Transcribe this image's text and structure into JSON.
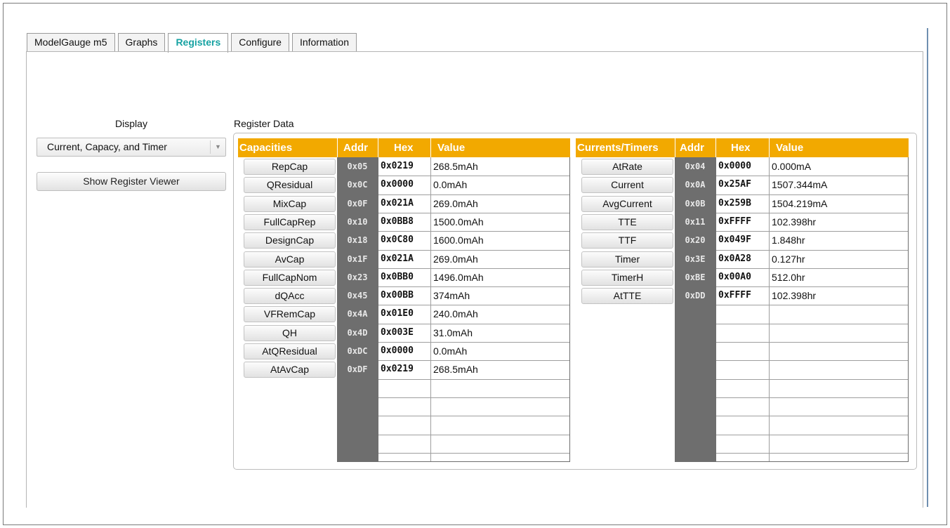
{
  "tabs": [
    "ModelGauge m5",
    "Graphs",
    "Registers",
    "Configure",
    "Information"
  ],
  "active_tab": "Registers",
  "display": {
    "label": "Display",
    "selected": "Current, Capacy, and Timer",
    "show_viewer_button": "Show Register Viewer"
  },
  "register_data_label": "Register Data",
  "capacities": {
    "headers": [
      "Capacities",
      "Addr",
      "Hex",
      "Value"
    ],
    "rows": [
      {
        "name": "RepCap",
        "addr": "0x05",
        "hex": "0x0219",
        "value": "268.5mAh"
      },
      {
        "name": "QResidual",
        "addr": "0x0C",
        "hex": "0x0000",
        "value": "0.0mAh"
      },
      {
        "name": "MixCap",
        "addr": "0x0F",
        "hex": "0x021A",
        "value": "269.0mAh"
      },
      {
        "name": "FullCapRep",
        "addr": "0x10",
        "hex": "0x0BB8",
        "value": "1500.0mAh"
      },
      {
        "name": "DesignCap",
        "addr": "0x18",
        "hex": "0x0C80",
        "value": "1600.0mAh"
      },
      {
        "name": "AvCap",
        "addr": "0x1F",
        "hex": "0x021A",
        "value": "269.0mAh"
      },
      {
        "name": "FullCapNom",
        "addr": "0x23",
        "hex": "0x0BB0",
        "value": "1496.0mAh"
      },
      {
        "name": "dQAcc",
        "addr": "0x45",
        "hex": "0x00BB",
        "value": "374mAh"
      },
      {
        "name": "VFRemCap",
        "addr": "0x4A",
        "hex": "0x01E0",
        "value": "240.0mAh"
      },
      {
        "name": "QH",
        "addr": "0x4D",
        "hex": "0x003E",
        "value": "31.0mAh"
      },
      {
        "name": "AtQResidual",
        "addr": "0xDC",
        "hex": "0x0000",
        "value": "0.0mAh"
      },
      {
        "name": "AtAvCap",
        "addr": "0xDF",
        "hex": "0x0219",
        "value": "268.5mAh"
      }
    ]
  },
  "currents": {
    "headers": [
      "Currents/Timers",
      "Addr",
      "Hex",
      "Value"
    ],
    "rows": [
      {
        "name": "AtRate",
        "addr": "0x04",
        "hex": "0x0000",
        "value": "0.000mA"
      },
      {
        "name": "Current",
        "addr": "0x0A",
        "hex": "0x25AF",
        "value": "1507.344mA"
      },
      {
        "name": "AvgCurrent",
        "addr": "0x0B",
        "hex": "0x259B",
        "value": "1504.219mA"
      },
      {
        "name": "TTE",
        "addr": "0x11",
        "hex": "0xFFFF",
        "value": "102.398hr"
      },
      {
        "name": "TTF",
        "addr": "0x20",
        "hex": "0x049F",
        "value": "1.848hr"
      },
      {
        "name": "Timer",
        "addr": "0x3E",
        "hex": "0x0A28",
        "value": "0.127hr"
      },
      {
        "name": "TimerH",
        "addr": "0xBE",
        "hex": "0x00A0",
        "value": "512.0hr"
      },
      {
        "name": "AtTTE",
        "addr": "0xDD",
        "hex": "0xFFFF",
        "value": "102.398hr"
      }
    ]
  },
  "colors": {
    "header_bg": "#f2a900",
    "active_tab": "#16a2a2",
    "addr_col": "#6e6e6e"
  }
}
